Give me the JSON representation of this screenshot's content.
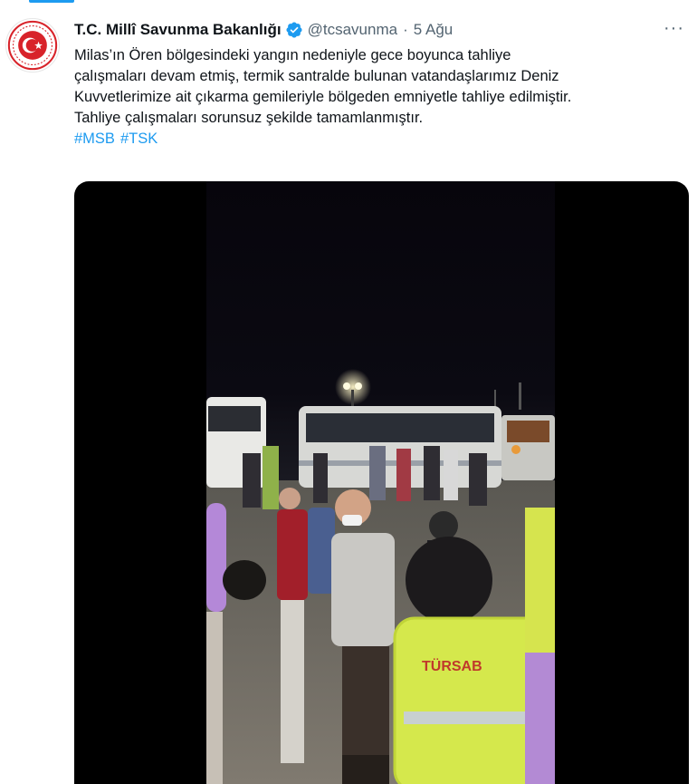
{
  "account": {
    "name": "T.C. Millî Savunma Bakanlığı",
    "handle": "@tcsavunma",
    "separator": "·",
    "time": "5 Ağu",
    "more_label": "···"
  },
  "tweet": {
    "lines": [
      "Milas’ın Ören bölgesindeki yangın nedeniyle gece boyunca tahliye",
      "çalışmaları devam etmiş, termik santralde bulunan vatandaşlarımız Deniz",
      "Kuvvetlerimize ait çıkarma gemileriyle bölgeden emniyetle tahliye edilmiştir.",
      "Tahliye çalışmaları sorunsuz şekilde tamamlanmıştır."
    ],
    "hashtags": [
      "#MSB",
      "#TSK"
    ]
  },
  "media": {
    "vest_text": "TÜRSAB"
  },
  "colors": {
    "accent": "#1d9bf0",
    "text": "#0f1419",
    "secondary": "#536471",
    "emblem_red": "#d8232a"
  },
  "icons": {
    "verified": "verified-badge-icon",
    "more": "more-options-icon",
    "avatar": "turkish-mod-emblem"
  }
}
